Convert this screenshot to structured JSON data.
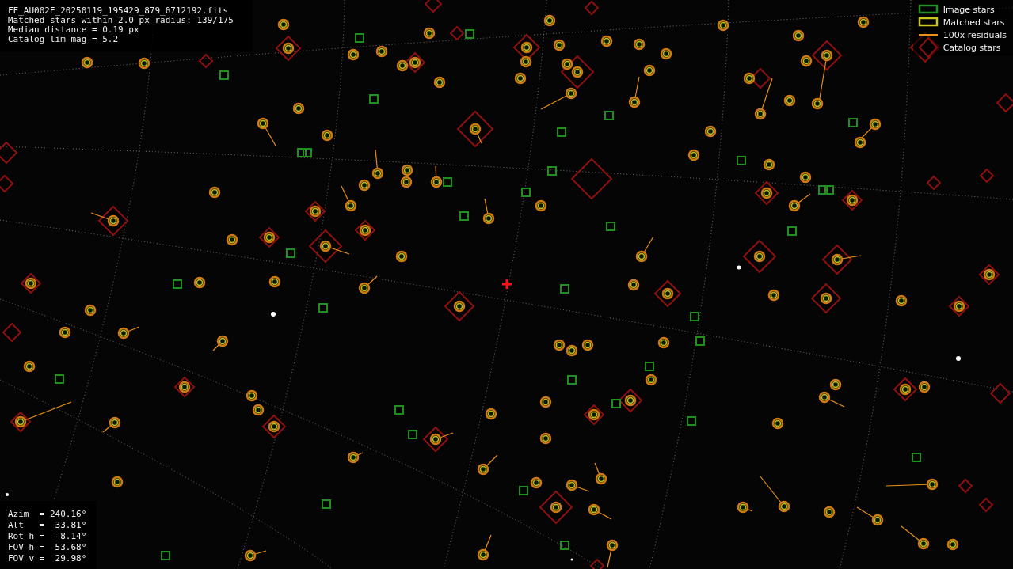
{
  "plot_info": [
    "FF_AU002E_20250119_195429_879_0712192.fits",
    "Matched stars within 2.0 px radius: 139/175",
    "Median distance = 0.19 px",
    "Catalog lim mag = 5.2"
  ],
  "legend": [
    {
      "kind": "box",
      "label": "Image stars",
      "color": "#1f8f1f"
    },
    {
      "kind": "box",
      "label": "Matched stars",
      "color": "#c8c820"
    },
    {
      "kind": "line",
      "label": "100x residuals",
      "color": "#e8901a"
    },
    {
      "kind": "diamond",
      "label": "Catalog stars",
      "color": "#8b1010"
    }
  ],
  "pointing": [
    "Azim  = 240.16°",
    "Alt   =  33.81°",
    "Rot h =  -8.14°",
    "FOV h =  53.68°",
    "FOV v =  29.98°"
  ]
}
